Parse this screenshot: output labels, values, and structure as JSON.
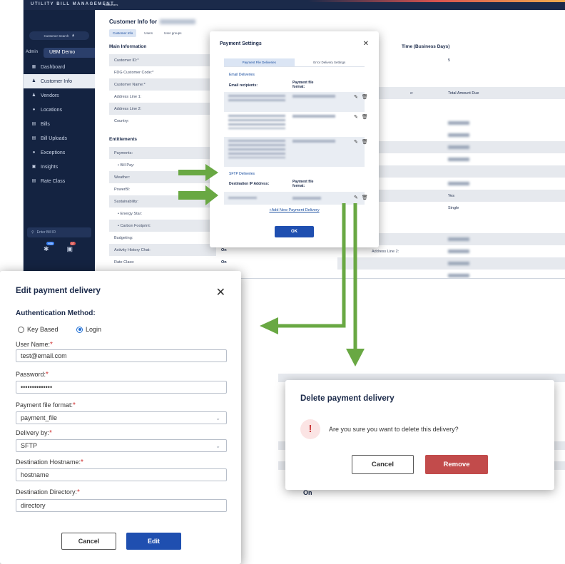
{
  "app": {
    "brand": "UTILITY BILL MANAGEMENT",
    "breadcrumb": "Customers",
    "sidebar": {
      "customer_search": "Customer Search",
      "admin_label": "Admin",
      "demo_label": "UBM Demo",
      "items": [
        {
          "label": "Dashboard",
          "icon": "dashboard-icon"
        },
        {
          "label": "Customer Info",
          "icon": "user-icon"
        },
        {
          "label": "Vendors",
          "icon": "vendor-icon"
        },
        {
          "label": "Locations",
          "icon": "location-pin-icon"
        },
        {
          "label": "Bills",
          "icon": "bill-icon"
        },
        {
          "label": "Bill Uploads",
          "icon": "upload-icon"
        },
        {
          "label": "Exceptions",
          "icon": "exception-icon"
        },
        {
          "label": "Insights",
          "icon": "insights-icon"
        },
        {
          "label": "Rate Class",
          "icon": "rate-class-icon"
        }
      ],
      "bill_id_placeholder": "Enter Bill ID",
      "badge_1": "+99",
      "badge_2": "37"
    },
    "main": {
      "title": "Customer Info for",
      "tabs": [
        "Customer Info",
        "Users",
        "User groups"
      ],
      "main_info_heading": "Main Information",
      "fields": [
        "Customer ID:*",
        "FDG Customer Code:*",
        "Customer Name:*",
        "Address Line 1:",
        "Address Line 2:",
        "Country:"
      ],
      "entitlements_heading": "Entitlements",
      "entitlements": [
        {
          "label": "Payments:",
          "value": ""
        },
        {
          "label": "Bill Pay:",
          "value": ""
        },
        {
          "label": "Weather:",
          "value": ""
        },
        {
          "label": "PowerBI:",
          "value": ""
        },
        {
          "label": "Sustainability:",
          "value": ""
        },
        {
          "label": "Energy Star:",
          "value": ""
        },
        {
          "label": "Carbon Footprint:",
          "value": ""
        },
        {
          "label": "Budgeting:",
          "value": ""
        },
        {
          "label": "Activity History Chat:",
          "value": "On"
        },
        {
          "label": "Rate Class:",
          "value": "On"
        }
      ],
      "right_heading": "Time (Business Days)",
      "right_rows": [
        {
          "label": "",
          "value": "5"
        },
        {
          "label": "e:",
          "value": "Total Amount Due"
        },
        {
          "label": "",
          "value": "Yes"
        },
        {
          "label": "",
          "value": "Single"
        },
        {
          "label": "Address Line 2:",
          "value": ""
        }
      ]
    }
  },
  "payment_modal": {
    "title": "Payment Settings",
    "tabs": [
      "Payment File Deliveries",
      "Error Delivery Settings"
    ],
    "email_heading": "Email Deliveries",
    "email_col_recipients": "Email recipients:",
    "email_col_format": "Payment file format:",
    "sftp_heading": "SFTP Deliveries",
    "sftp_col_ip": "Destination IP Address:",
    "sftp_col_format": "Payment file format:",
    "add_link": "+Add New Payment Delivery",
    "ok_label": "OK"
  },
  "edit_modal": {
    "title": "Edit payment delivery",
    "auth_heading": "Authentication Method:",
    "auth_options": [
      {
        "label": "Key Based",
        "selected": false
      },
      {
        "label": "Login",
        "selected": true
      }
    ],
    "username_label": "User Name:",
    "username_value": "test@email.com",
    "password_label": "Password:",
    "password_value": "••••••••••••••",
    "format_label": "Payment file format:",
    "format_value": "payment_file",
    "delivery_label": "Delivery by:",
    "delivery_value": "SFTP",
    "hostname_label": "Destination Hostname:",
    "hostname_value": "hostname",
    "directory_label": "Destination Directory:",
    "directory_value": "directory",
    "cancel_label": "Cancel",
    "edit_label": "Edit"
  },
  "delete_modal": {
    "title": "Delete payment delivery",
    "message": "Are you sure you want to delete this delivery?",
    "cancel_label": "Cancel",
    "remove_label": "Remove"
  },
  "background_fragment": {
    "on_text": "On"
  },
  "colors": {
    "arrow": "#69a843",
    "primary": "#1f4fb0",
    "danger": "#c24b4b",
    "sidebar": "#142341"
  }
}
